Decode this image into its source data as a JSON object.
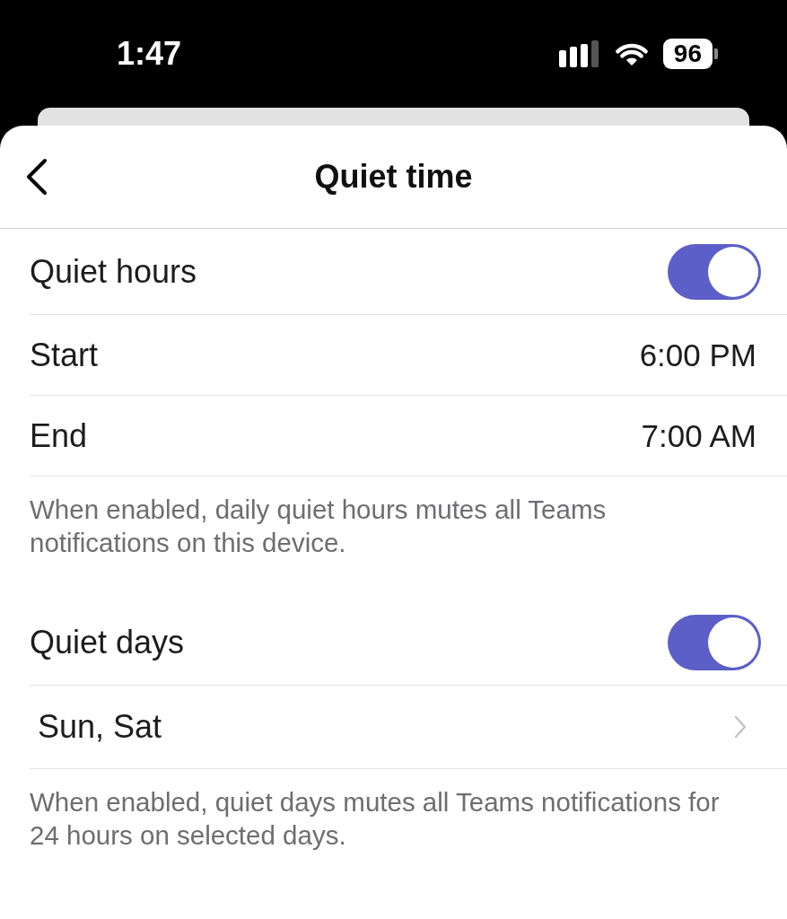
{
  "status_bar": {
    "time": "1:47",
    "battery": "96"
  },
  "header": {
    "title": "Quiet time"
  },
  "sections": [
    {
      "rows": [
        {
          "kind": "toggle",
          "label": "Quiet hours",
          "on": true
        },
        {
          "kind": "value",
          "label": "Start",
          "value": "6:00 PM"
        },
        {
          "kind": "value",
          "label": "End",
          "value": "7:00 AM"
        }
      ],
      "footnote": "When enabled, daily quiet hours mutes all Teams notifications on this device."
    },
    {
      "rows": [
        {
          "kind": "toggle",
          "label": "Quiet days",
          "on": true
        },
        {
          "kind": "link",
          "label": "Sun, Sat"
        }
      ],
      "footnote": "When enabled, quiet days mutes all Teams notifications for 24 hours on selected days."
    }
  ]
}
